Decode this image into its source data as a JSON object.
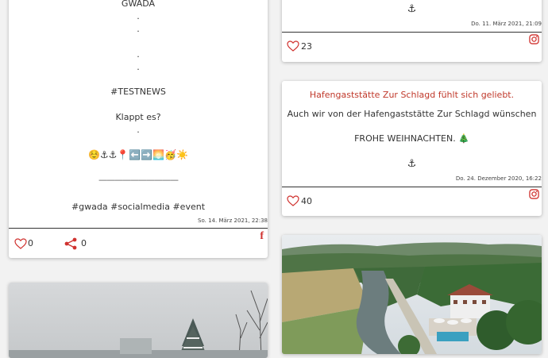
{
  "posts": [
    {
      "lines": [
        "GWADA",
        ".",
        ".",
        ".",
        ".",
        "#TESTNEWS",
        "Klappt es?",
        ".",
        "☺️⚓⚓📍⬅️➡️🌅🥳☀️",
        "——————————",
        "#gwada #socialmedia #event"
      ],
      "date": "So. 14. März 2021, 22:38",
      "likes": "0",
      "shares": "0",
      "network_icon": "facebook-icon"
    },
    {
      "lines": [
        "⚓"
      ],
      "date": "Do. 11. März 2021, 21:09",
      "likes": "23",
      "network_icon": "instagram-icon"
    },
    {
      "title": "Hafengaststätte Zur Schlagd fühlt sich geliebt.",
      "lines": [
        "Auch wir von der Hafengaststätte Zur Schlagd wünschen",
        "FROHE WEIHNACHTEN. 🎄",
        "⚓"
      ],
      "date": "Do. 24. Dezember 2020, 16:22",
      "likes": "40",
      "network_icon": "instagram-icon"
    }
  ],
  "colors": {
    "accent_red": "#c0392b",
    "facebook": "#d0322f",
    "instagram": "#d0322f",
    "heart": "#d0322f"
  }
}
